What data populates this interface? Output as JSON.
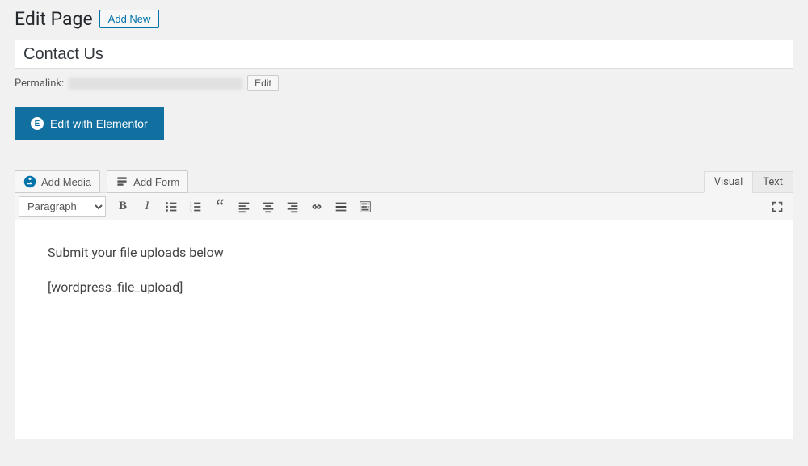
{
  "header": {
    "heading": "Edit Page",
    "add_new_label": "Add New"
  },
  "title_value": "Contact Us",
  "permalink": {
    "label": "Permalink:",
    "edit_label": "Edit"
  },
  "elementor": {
    "label": "Edit with Elementor",
    "icon_glyph": "E"
  },
  "media_buttons": {
    "add_media": "Add Media",
    "add_form": "Add Form"
  },
  "tabs": {
    "visual": "Visual",
    "text": "Text"
  },
  "toolbar": {
    "format_selected": "Paragraph"
  },
  "content": {
    "line1": "Submit your file uploads below",
    "line2": "[wordpress_file_upload]"
  }
}
